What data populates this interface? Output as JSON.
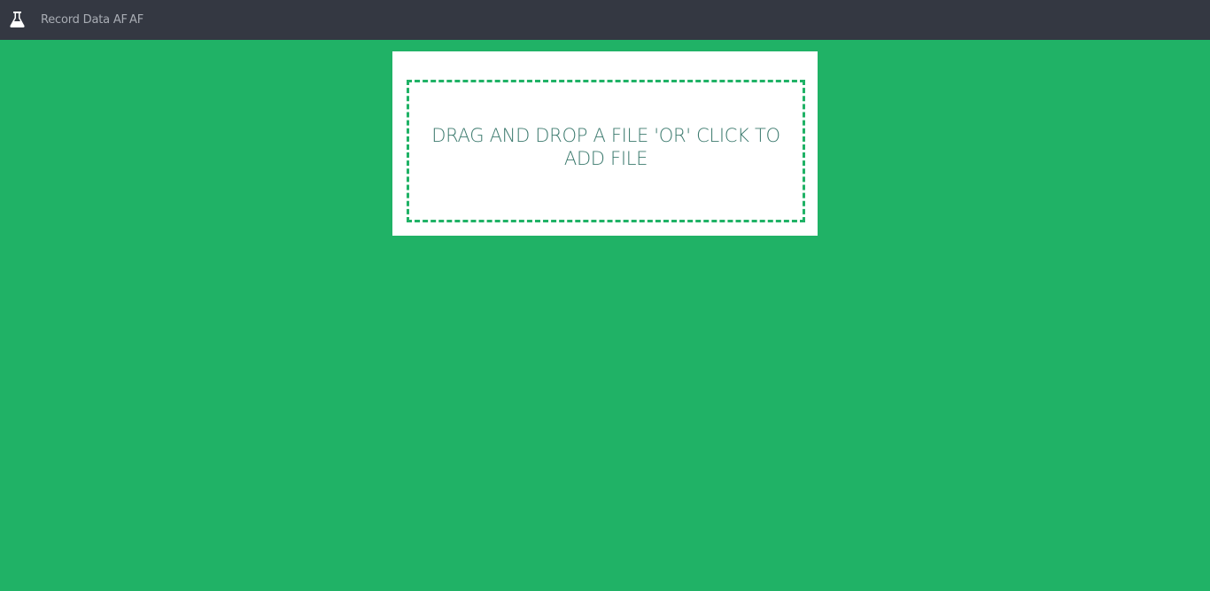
{
  "navbar": {
    "brand_icon": "flask-icon",
    "items": [
      {
        "label": "Record Data AF"
      },
      {
        "label": "AF"
      }
    ],
    "background_color": "#343842",
    "text_color": "#a9adb4"
  },
  "upload": {
    "dropzone_text": "DRAG AND DROP A FILE 'OR' CLICK TO ADD FILE",
    "border_color": "#20b266",
    "text_color": "#3c7a6e"
  },
  "page": {
    "background_color": "#20b266"
  }
}
